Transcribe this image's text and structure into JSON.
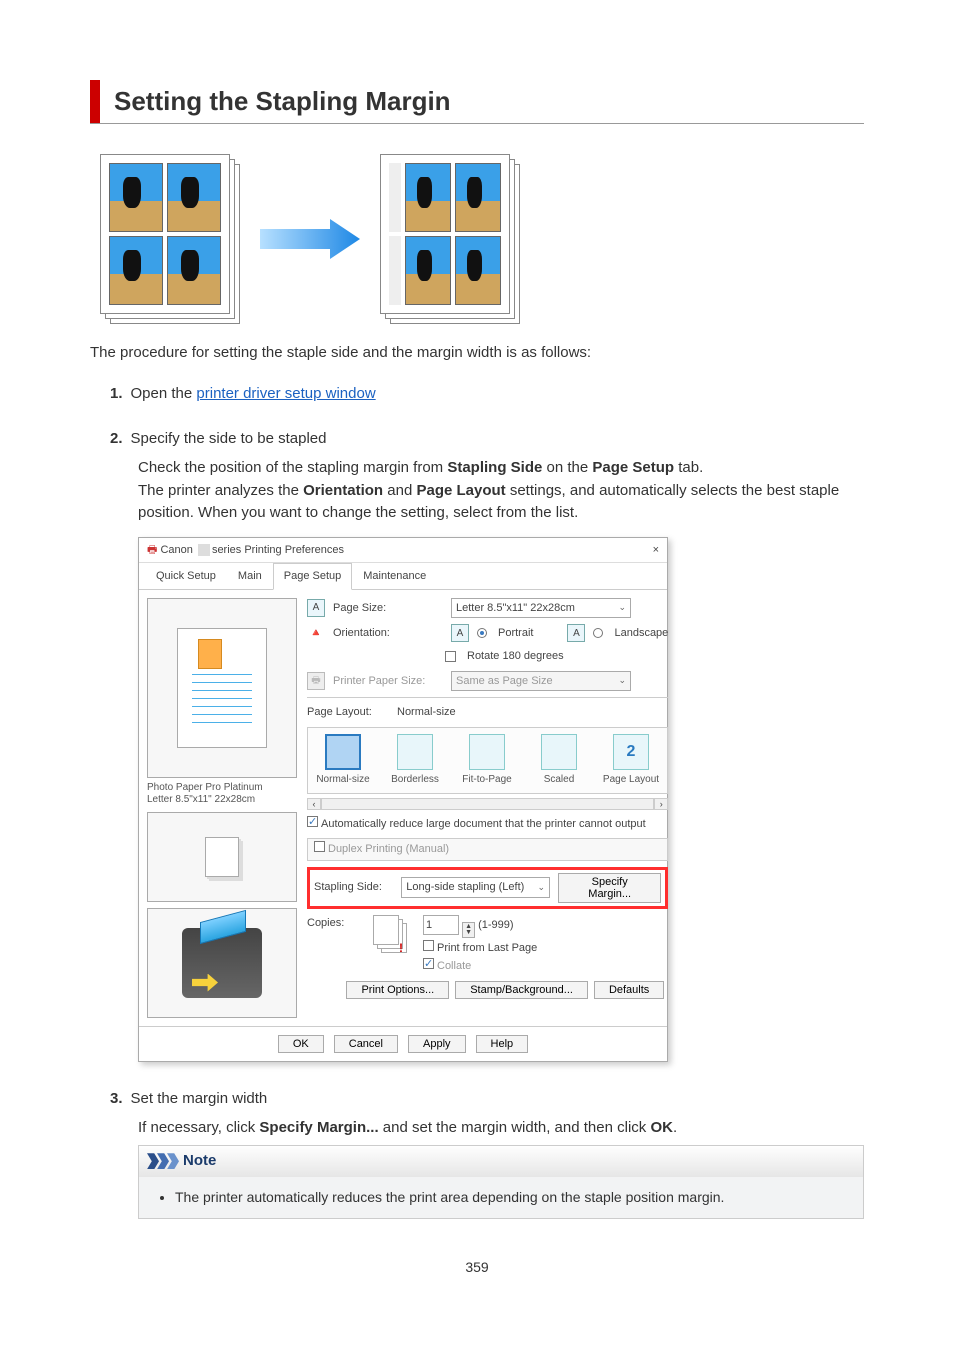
{
  "title": "Setting the Stapling Margin",
  "intro": "The procedure for setting the staple side and the margin width is as follows:",
  "steps": [
    {
      "num": "1.",
      "title_prefix": "Open the ",
      "link_text": "printer driver setup window"
    },
    {
      "num": "2.",
      "title": "Specify the side to be stapled",
      "body_before": "Check the position of the stapling margin from ",
      "bold1": "Stapling Side",
      "body_mid1": " on the ",
      "bold2": "Page Setup",
      "body_mid2": " tab.",
      "body2_before": "The printer analyzes the ",
      "bold3": "Orientation",
      "body2_mid1": " and ",
      "bold4": "Page Layout",
      "body2_after": " settings, and automatically selects the best staple position. When you want to change the setting, select from the list."
    },
    {
      "num": "3.",
      "title": "Set the margin width",
      "body_before": "If necessary, click ",
      "bold1": "Specify Margin...",
      "body_mid": " and set the margin width, and then click ",
      "bold2": "OK",
      "body_after": "."
    }
  ],
  "dialog": {
    "titlebar_prefix": "Canon",
    "titlebar_suffix": " series Printing Preferences",
    "close": "×",
    "tabs": [
      "Quick Setup",
      "Main",
      "Page Setup",
      "Maintenance"
    ],
    "active_tab": 2,
    "page_size_lbl": "Page Size:",
    "page_size_val": "Letter 8.5\"x11\" 22x28cm",
    "orientation_lbl": "Orientation:",
    "portrait": "Portrait",
    "landscape": "Landscape",
    "rotate": "Rotate 180 degrees",
    "printer_paper_lbl": "Printer Paper Size:",
    "printer_paper_val": "Same as Page Size",
    "page_layout_lbl": "Page Layout:",
    "page_layout_val": "Normal-size",
    "layout_options": [
      "Normal-size",
      "Borderless",
      "Fit-to-Page",
      "Scaled",
      "Page Layout"
    ],
    "preview_label_line1": "Photo Paper Pro Platinum",
    "preview_label_line2": "Letter 8.5\"x11\" 22x28cm",
    "auto_reduce": "Automatically reduce large document that the printer cannot output",
    "duplex_group": "Duplex Printing (Manual)",
    "stapling_side_lbl": "Stapling Side:",
    "stapling_side_val": "Long-side stapling (Left)",
    "specify_margin_btn": "Specify Margin...",
    "copies_lbl": "Copies:",
    "copies_val": "1",
    "copies_range": "(1-999)",
    "print_last": "Print from Last Page",
    "collate": "Collate",
    "inner_buttons": [
      "Print Options...",
      "Stamp/Background...",
      "Defaults"
    ],
    "bottom_buttons": [
      "OK",
      "Cancel",
      "Apply",
      "Help"
    ]
  },
  "note": {
    "heading": "Note",
    "bullet": "The printer automatically reduces the print area depending on the staple position margin."
  },
  "page_number": "359"
}
